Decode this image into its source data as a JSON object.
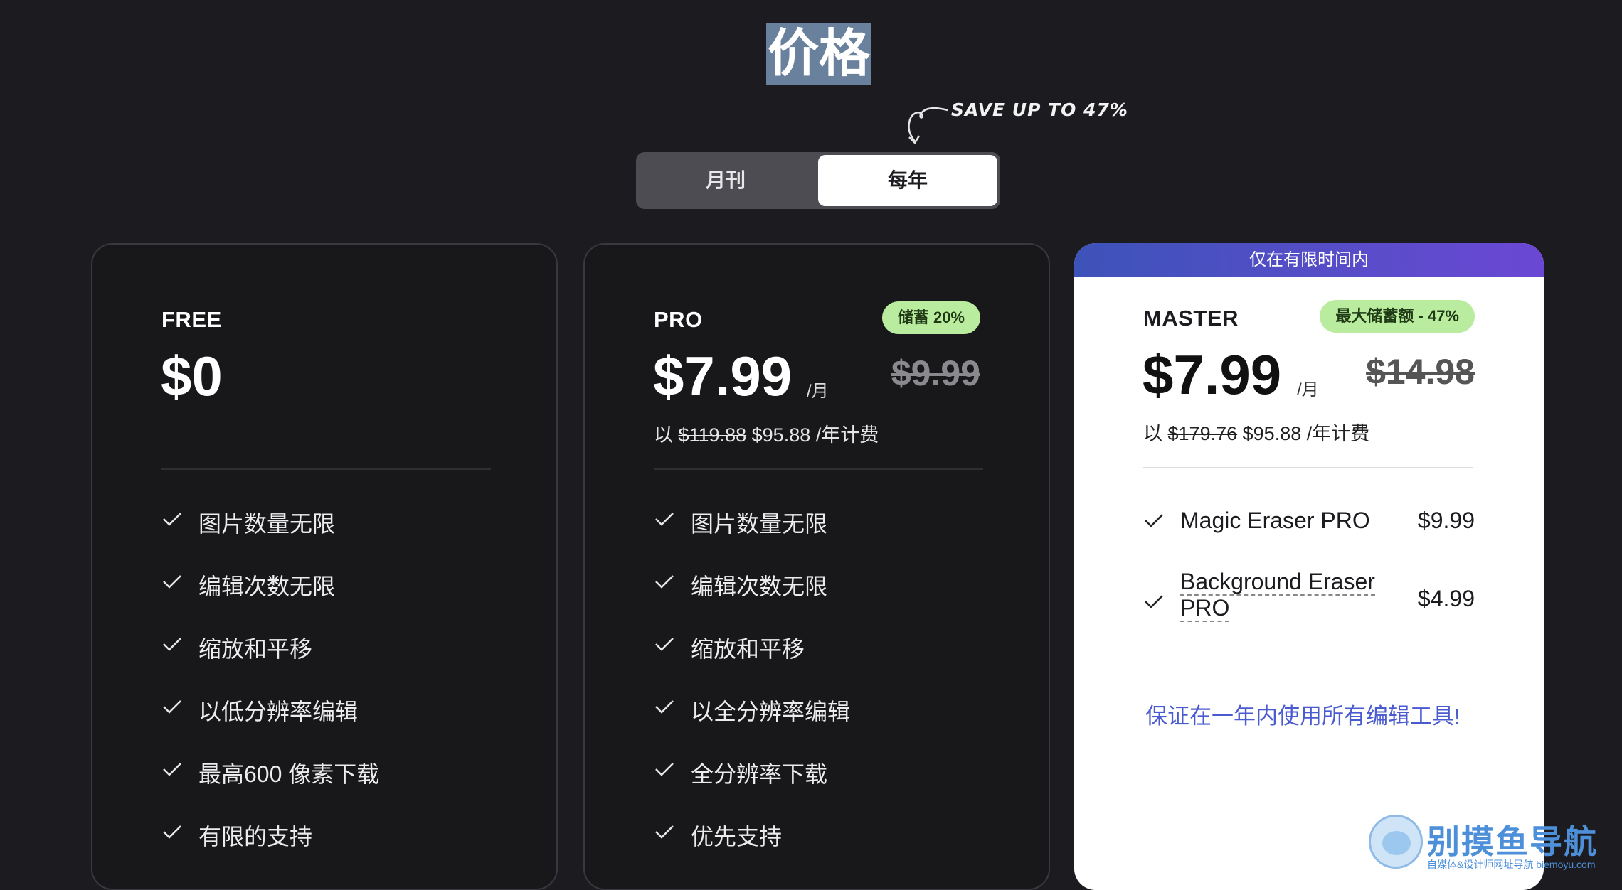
{
  "page": {
    "title": "价格"
  },
  "promo": {
    "save_note": "SAVE UP TO 47%"
  },
  "billing_toggle": {
    "monthly_label": "月刊",
    "yearly_label": "每年",
    "selected": "yearly"
  },
  "plans": {
    "free": {
      "name": "FREE",
      "price": "$0",
      "features": [
        "图片数量无限",
        "编辑次数无限",
        "缩放和平移",
        "以低分辨率编辑",
        "最高600 像素下载",
        "有限的支持"
      ]
    },
    "pro": {
      "name": "PRO",
      "badge": "储蓄 20%",
      "price": "$7.99",
      "per": "/月",
      "old_price": "$9.99",
      "billing_prefix": "以",
      "billing_old": "$119.88",
      "billing_new": "$95.88 /年计费",
      "features": [
        "图片数量无限",
        "编辑次数无限",
        "缩放和平移",
        "以全分辨率编辑",
        "全分辨率下载",
        "优先支持"
      ]
    },
    "master": {
      "banner": "仅在有限时间内",
      "name": "MASTER",
      "badge": "最大储蓄额 - 47%",
      "price": "$7.99",
      "per": "/月",
      "old_price": "$14.98",
      "billing_prefix": "以",
      "billing_old": "$179.76",
      "billing_new": "$95.88 /年计费",
      "addons": [
        {
          "name": "Magic Eraser PRO",
          "price": "$9.99"
        },
        {
          "name_line1": "Background Eraser",
          "name_line2": "PRO",
          "price": "$4.99"
        }
      ],
      "guarantee": "保证在一年内使用所有编辑工具!"
    }
  },
  "watermark": {
    "title": "别摸鱼导航",
    "subtitle": "自媒体&设计师网址导航 biemoyu.com"
  },
  "colors": {
    "background": "#1c1c20",
    "accent_badge": "#b9ec9f",
    "banner_start": "#3d53b9",
    "banner_end": "#6b48d4",
    "guarantee": "#4a5bd0"
  }
}
